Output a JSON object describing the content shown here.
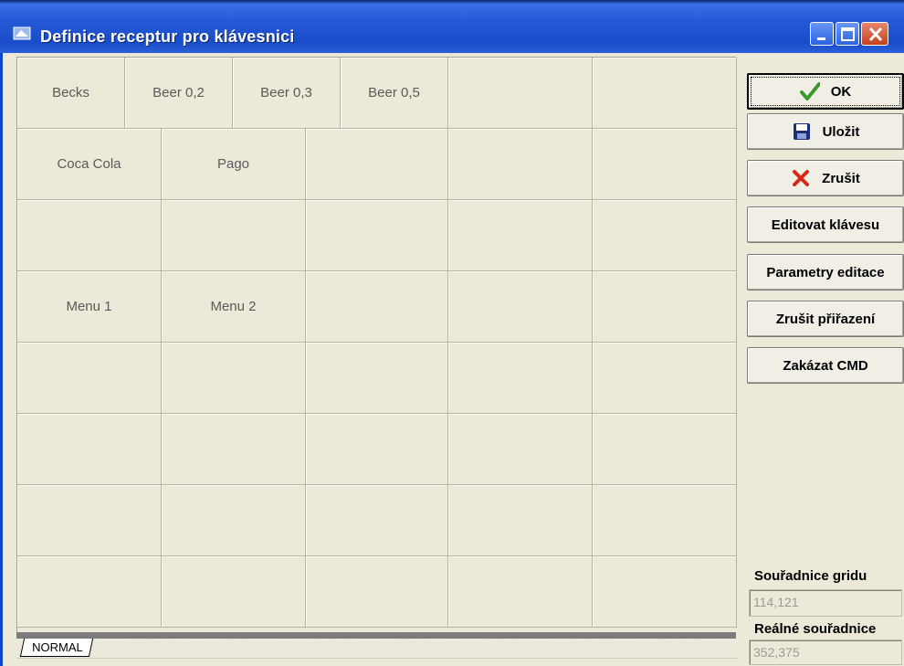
{
  "window": {
    "title": "Definice receptur pro klávesnici",
    "controls": [
      "minimize",
      "maximize",
      "close"
    ]
  },
  "grid": {
    "rows": [
      [
        "Becks",
        "Beer 0,2",
        "Beer 0,3",
        "Beer 0,5",
        "",
        ""
      ],
      [
        "Coca Cola",
        "Pago",
        "",
        "",
        ""
      ],
      [
        "",
        "",
        "",
        "",
        ""
      ],
      [
        "Menu 1",
        "Menu 2",
        "",
        "",
        ""
      ],
      [
        "",
        "",
        "",
        "",
        ""
      ],
      [
        "",
        "",
        "",
        "",
        ""
      ],
      [
        "",
        "",
        "",
        "",
        ""
      ],
      [
        "",
        "",
        "",
        "",
        ""
      ]
    ]
  },
  "tabs": [
    "NORMAL"
  ],
  "buttons": {
    "ok": "OK",
    "save": "Uložit",
    "cancel": "Zrušit",
    "edit_key": "Editovat klávesu",
    "edit_params": "Parametry editace",
    "unassign": "Zrušit přiřazení",
    "disable_cmd": "Zakázat CMD"
  },
  "coordinates": {
    "grid_label": "Souřadnice gridu",
    "grid_value": "114,121",
    "real_label": "Reálné souřadnice",
    "real_value": "352,375"
  },
  "colors": {
    "titlebar": "#2459d6",
    "face": "#ece9d8",
    "ok_icon": "#3a9a2c",
    "cancel_icon": "#d8261a",
    "save_icon": "#1a2f7a"
  }
}
